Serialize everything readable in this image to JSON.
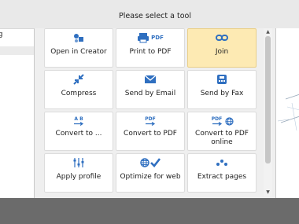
{
  "dialog": {
    "title": "Please select a tool"
  },
  "left_panel": {
    "items": [
      {
        "label": "ng"
      }
    ]
  },
  "tools": [
    {
      "label": "Open in Creator",
      "icon": "open-in-creator-icon"
    },
    {
      "label": "Print to PDF",
      "icon": "print-to-pdf-icon"
    },
    {
      "label": "Join",
      "icon": "join-icon",
      "selected": true
    },
    {
      "label": "Compress",
      "icon": "compress-icon"
    },
    {
      "label": "Send by Email",
      "icon": "email-icon"
    },
    {
      "label": "Send by Fax",
      "icon": "fax-icon"
    },
    {
      "label": "Convert to ...",
      "icon": "convert-ab-icon"
    },
    {
      "label": "Convert to PDF",
      "icon": "convert-to-pdf-icon"
    },
    {
      "label": "Convert to PDF\nonline",
      "icon": "convert-to-pdf-online-icon"
    },
    {
      "label": "Apply profile",
      "icon": "sliders-icon"
    },
    {
      "label": "Optimize for web",
      "icon": "optimize-web-icon"
    },
    {
      "label": "Extract pages",
      "icon": "extract-pages-icon"
    }
  ],
  "icon_text": {
    "pdf": "PDF",
    "ab": "A B"
  },
  "colors": {
    "accent": "#2f6fc0",
    "selected_tile": "#fdeab3",
    "footer": "#6b6b6b"
  },
  "scrollbar": {
    "up_arrow": "▲",
    "down_arrow": "▼"
  }
}
